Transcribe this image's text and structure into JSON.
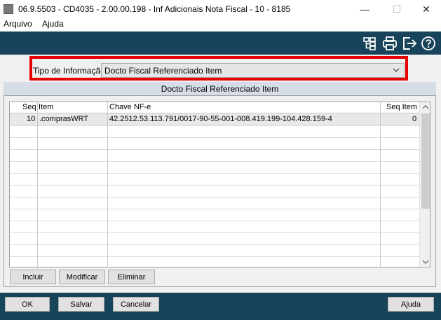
{
  "window": {
    "title": "06.9.5503 - CD4035 - 2.00.00.198 - Inf Adicionais Nota Fiscal - 10 - 8185",
    "minimize": "—",
    "maximize": "☐",
    "close": "✕"
  },
  "menu": {
    "items": [
      "Arquivo",
      "Ajuda"
    ]
  },
  "toolbar": {
    "icons": [
      "tree-icon",
      "print-icon",
      "exit-icon",
      "help-icon"
    ],
    "background": "#17445a"
  },
  "tipo": {
    "label": "Tipo de Informação:",
    "selected": "Docto Fiscal Referenciado Item"
  },
  "group": {
    "title": "Docto Fiscal Referenciado Item"
  },
  "grid": {
    "columns": [
      "Seq",
      "Item",
      "Chave NF-e",
      "Seq Item"
    ],
    "rows": [
      {
        "seq": "10",
        "item": ".comprasWRT",
        "chave": "42.2512.53.113.791/0017-90-55-001-008.419.199-104.428.159-4",
        "seq_item": "0"
      }
    ]
  },
  "buttons": {
    "incluir": "Incluir",
    "modificar": "Modificar",
    "eliminar": "Eliminar"
  },
  "footer": {
    "ok": "OK",
    "salvar": "Salvar",
    "cancelar": "Cancelar",
    "ajuda": "Ajuda"
  },
  "colors": {
    "accent": "#17445a",
    "highlight": "#e60000",
    "group_header": "#d6dde7"
  }
}
